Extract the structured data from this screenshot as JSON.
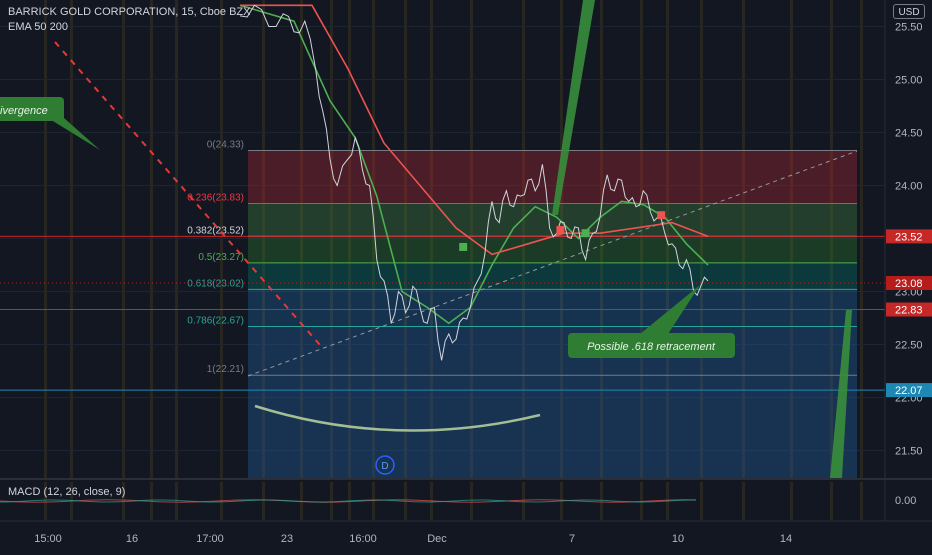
{
  "header": {
    "symbol": "BARRICK GOLD CORPORATION, 15, Cboe BZX",
    "indicator": "EMA 50 200",
    "currency": "USD"
  },
  "macd": {
    "label": "MACD (12, 26, close, 9)",
    "axis_label": "0.00"
  },
  "annotations": {
    "divergence": "ivergence",
    "retracement": "Possible .618 retracement",
    "event_marker": "D"
  },
  "price_tags": [
    {
      "value": 23.52,
      "label": "23.52",
      "color": "#c62828"
    },
    {
      "value": 23.08,
      "label": "23.08",
      "color": "#b71c1c"
    },
    {
      "value": 22.83,
      "label": "22.83",
      "color": "#c62828"
    },
    {
      "value": 22.07,
      "label": "22.07",
      "color": "#1e88b4"
    }
  ],
  "chart_data": {
    "type": "line",
    "title": "BARRICK GOLD CORPORATION, 15, Cboe BZX",
    "y_axis": {
      "ylim": [
        21.3,
        25.7
      ],
      "ticks": [
        25.5,
        25.0,
        24.5,
        24.0,
        23.5,
        23.0,
        22.5,
        22.0,
        21.5
      ],
      "tick_labels": [
        "25.50",
        "25.00",
        "24.50",
        "24.00",
        "23.50",
        "23.00",
        "22.50",
        "22.00",
        "21.50"
      ]
    },
    "x_axis": {
      "tick_labels": [
        "15:00",
        "16",
        "17:00",
        "23",
        "16:00",
        "Dec",
        "7",
        "10",
        "14"
      ]
    },
    "price": [
      {
        "t": 0,
        "v": 25.6
      },
      {
        "t": 4,
        "v": 25.7
      },
      {
        "t": 8,
        "v": 25.5
      },
      {
        "t": 12,
        "v": 25.62
      },
      {
        "t": 15,
        "v": 25.45
      },
      {
        "t": 18,
        "v": 25.55
      },
      {
        "t": 21,
        "v": 25.1
      },
      {
        "t": 23,
        "v": 24.7
      },
      {
        "t": 25,
        "v": 24.25
      },
      {
        "t": 27,
        "v": 24.0
      },
      {
        "t": 30,
        "v": 24.25
      },
      {
        "t": 32,
        "v": 24.45
      },
      {
        "t": 34,
        "v": 24.15
      },
      {
        "t": 36,
        "v": 24.0
      },
      {
        "t": 38,
        "v": 23.3
      },
      {
        "t": 40,
        "v": 23.1
      },
      {
        "t": 42,
        "v": 22.7
      },
      {
        "t": 44,
        "v": 23.0
      },
      {
        "t": 46,
        "v": 22.8
      },
      {
        "t": 48,
        "v": 23.05
      },
      {
        "t": 50,
        "v": 22.85
      },
      {
        "t": 52,
        "v": 22.7
      },
      {
        "t": 54,
        "v": 22.85
      },
      {
        "t": 56,
        "v": 22.35
      },
      {
        "t": 58,
        "v": 22.6
      },
      {
        "t": 60,
        "v": 22.55
      },
      {
        "t": 62,
        "v": 22.75
      },
      {
        "t": 64,
        "v": 22.85
      },
      {
        "t": 66,
        "v": 23.1
      },
      {
        "t": 68,
        "v": 23.35
      },
      {
        "t": 70,
        "v": 23.85
      },
      {
        "t": 72,
        "v": 23.65
      },
      {
        "t": 74,
        "v": 23.95
      },
      {
        "t": 76,
        "v": 23.8
      },
      {
        "t": 78,
        "v": 23.9
      },
      {
        "t": 80,
        "v": 24.05
      },
      {
        "t": 82,
        "v": 23.95
      },
      {
        "t": 84,
        "v": 24.2
      },
      {
        "t": 86,
        "v": 23.6
      },
      {
        "t": 88,
        "v": 23.55
      },
      {
        "t": 90,
        "v": 23.65
      },
      {
        "t": 92,
        "v": 23.5
      },
      {
        "t": 94,
        "v": 23.6
      },
      {
        "t": 96,
        "v": 23.3
      },
      {
        "t": 98,
        "v": 23.55
      },
      {
        "t": 100,
        "v": 23.7
      },
      {
        "t": 102,
        "v": 24.1
      },
      {
        "t": 104,
        "v": 23.95
      },
      {
        "t": 106,
        "v": 24.05
      },
      {
        "t": 108,
        "v": 23.85
      },
      {
        "t": 110,
        "v": 23.8
      },
      {
        "t": 112,
        "v": 23.95
      },
      {
        "t": 114,
        "v": 23.75
      },
      {
        "t": 116,
        "v": 23.7
      },
      {
        "t": 118,
        "v": 23.55
      },
      {
        "t": 120,
        "v": 23.45
      },
      {
        "t": 122,
        "v": 23.25
      },
      {
        "t": 124,
        "v": 23.3
      },
      {
        "t": 126,
        "v": 23.0
      },
      {
        "t": 128,
        "v": 23.05
      },
      {
        "t": 130,
        "v": 23.1
      }
    ],
    "series": [
      {
        "name": "EMA 50",
        "color": "#4caf50",
        "values": [
          {
            "t": 0,
            "v": 25.7
          },
          {
            "t": 15,
            "v": 25.55
          },
          {
            "t": 25,
            "v": 24.8
          },
          {
            "t": 32,
            "v": 24.45
          },
          {
            "t": 38,
            "v": 23.9
          },
          {
            "t": 45,
            "v": 23.0
          },
          {
            "t": 52,
            "v": 22.85
          },
          {
            "t": 58,
            "v": 22.7
          },
          {
            "t": 64,
            "v": 22.85
          },
          {
            "t": 70,
            "v": 23.25
          },
          {
            "t": 76,
            "v": 23.6
          },
          {
            "t": 82,
            "v": 23.8
          },
          {
            "t": 88,
            "v": 23.7
          },
          {
            "t": 94,
            "v": 23.5
          },
          {
            "t": 100,
            "v": 23.7
          },
          {
            "t": 106,
            "v": 23.85
          },
          {
            "t": 112,
            "v": 23.82
          },
          {
            "t": 118,
            "v": 23.7
          },
          {
            "t": 124,
            "v": 23.45
          },
          {
            "t": 130,
            "v": 23.25
          }
        ]
      },
      {
        "name": "EMA 200",
        "color": "#ef5350",
        "values": [
          {
            "t": 0,
            "v": 25.7
          },
          {
            "t": 20,
            "v": 25.7
          },
          {
            "t": 30,
            "v": 25.1
          },
          {
            "t": 40,
            "v": 24.4
          },
          {
            "t": 50,
            "v": 24.0
          },
          {
            "t": 60,
            "v": 23.6
          },
          {
            "t": 70,
            "v": 23.35
          },
          {
            "t": 80,
            "v": 23.45
          },
          {
            "t": 90,
            "v": 23.55
          },
          {
            "t": 100,
            "v": 23.55
          },
          {
            "t": 110,
            "v": 23.6
          },
          {
            "t": 120,
            "v": 23.65
          },
          {
            "t": 130,
            "v": 23.52
          }
        ]
      }
    ],
    "fibonacci": [
      {
        "ratio_label": "0(24.33)",
        "price": 24.33,
        "color": "#787b86"
      },
      {
        "ratio_label": "0.236(23.83)",
        "price": 23.83,
        "color": "#f23645"
      },
      {
        "ratio_label": "0.382(23.52)",
        "price": 23.52,
        "color": "#d1d4dc"
      },
      {
        "ratio_label": "0.5(23.27)",
        "price": 23.27,
        "color": "#4caf50"
      },
      {
        "ratio_label": "0.618(23.02)",
        "price": 23.02,
        "color": "#26a69a"
      },
      {
        "ratio_label": "0.786(22.67)",
        "price": 22.67,
        "color": "#26a69a"
      },
      {
        "ratio_label": "1(22.21)",
        "price": 22.21,
        "color": "#787b86"
      }
    ],
    "fib_zone_bottom": 21.3,
    "horizontal_lines": [
      {
        "price": 23.52,
        "color": "#c62828"
      },
      {
        "price": 22.83,
        "color": "#c62828"
      },
      {
        "price": 22.07,
        "color": "#1e88b4"
      }
    ],
    "last_price": 23.08
  }
}
